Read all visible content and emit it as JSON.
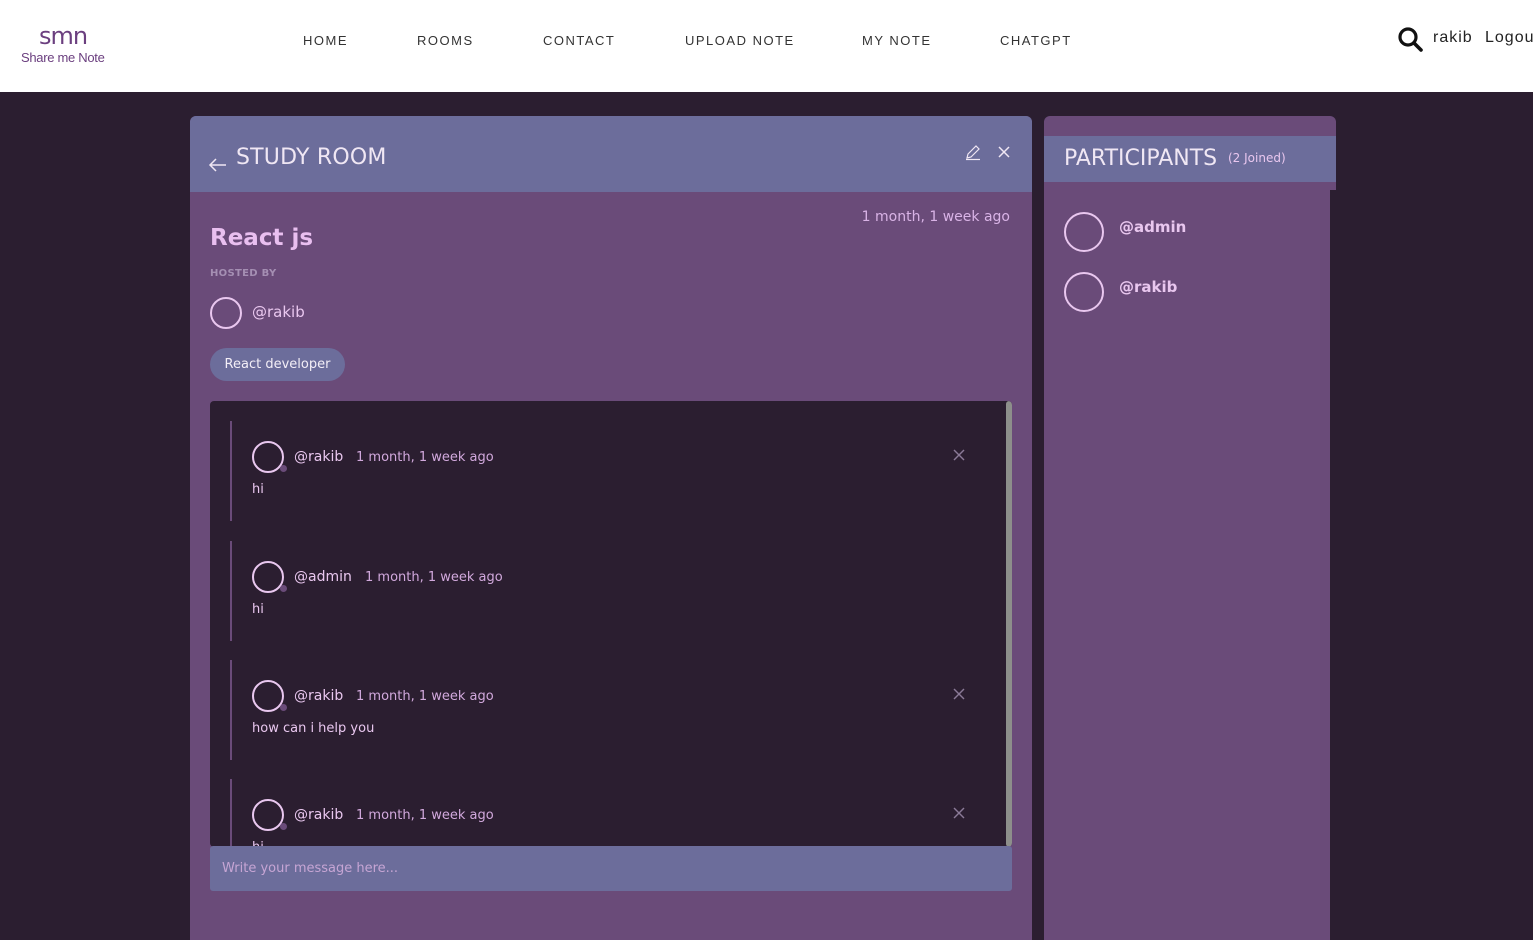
{
  "brand": {
    "mark": "smn",
    "name": "Share me Note"
  },
  "nav": {
    "items": [
      "HOME",
      "ROOMS",
      "CONTACT",
      "UPLOAD NOTE",
      "MY NOTE",
      "CHATGPT"
    ],
    "user": "rakib",
    "logout": "Logout"
  },
  "room": {
    "header_title": "STUDY ROOM",
    "created": "1 month, 1 week ago",
    "name": "React js",
    "hosted_label": "HOSTED BY",
    "host": "@rakib",
    "topic": "React developer"
  },
  "messages": [
    {
      "user": "@rakib",
      "time": "1 month, 1 week ago",
      "text": "hi",
      "deletable": true
    },
    {
      "user": "@admin",
      "time": "1 month, 1 week ago",
      "text": "hi",
      "deletable": false
    },
    {
      "user": "@rakib",
      "time": "1 month, 1 week ago",
      "text": "how can i help you",
      "deletable": true
    },
    {
      "user": "@rakib",
      "time": "1 month, 1 week ago",
      "text": "hi",
      "deletable": true
    }
  ],
  "composer": {
    "placeholder": "Write your message here..."
  },
  "participants": {
    "title": "PARTICIPANTS",
    "count_label": "(2 Joined)",
    "items": [
      "@admin",
      "@rakib"
    ]
  },
  "colors": {
    "background": "#2b1e30",
    "panel": "#6a4b79",
    "header": "#6c6d9b",
    "accent_text": "#e9c7ef"
  }
}
